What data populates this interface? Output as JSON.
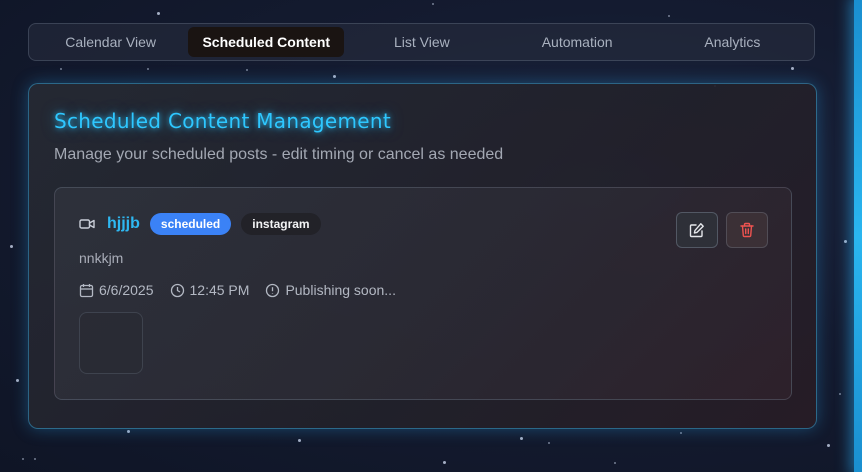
{
  "tabs": [
    {
      "label": "Calendar View",
      "active": false
    },
    {
      "label": "Scheduled Content",
      "active": true
    },
    {
      "label": "List View",
      "active": false
    },
    {
      "label": "Automation",
      "active": false
    },
    {
      "label": "Analytics",
      "active": false
    }
  ],
  "panel": {
    "title": "Scheduled Content Management",
    "subtitle": "Manage your scheduled posts - edit timing or cancel as needed"
  },
  "post": {
    "type_icon": "video-icon",
    "title": "hjjjb",
    "status": "scheduled",
    "platform": "instagram",
    "description": "nnkkjm",
    "date": "6/6/2025",
    "time": "12:45 PM",
    "publish_status": "Publishing soon..."
  },
  "actions": {
    "edit_icon": "edit-icon",
    "delete_icon": "trash-icon"
  },
  "colors": {
    "accent": "#2ec7ff",
    "status_badge": "#3b82f6",
    "delete": "#ef5350",
    "background": "#141b30"
  }
}
